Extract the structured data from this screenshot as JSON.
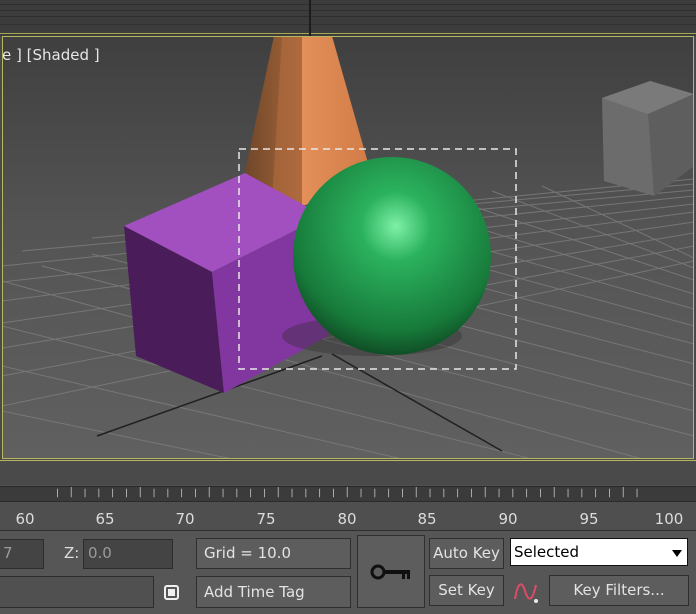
{
  "viewport": {
    "label": "e ] [Shaded ]"
  },
  "timeline": {
    "tick_labels": [
      "60",
      "65",
      "70",
      "75",
      "80",
      "85",
      "90",
      "95",
      "100"
    ]
  },
  "status_bar": {
    "x_field_value": "7",
    "z_label": "Z:",
    "z_field_value": "0.0",
    "grid_label": "Grid = 10.0",
    "add_time_tag_label": "Add Time Tag",
    "auto_key_label": "Auto Key",
    "set_key_label": "Set Key",
    "key_mode_selected": "Selected",
    "key_filters_label": "Key Filters...",
    "key_icon": "key-icon",
    "curve_icon": "curve-editor-icon",
    "lock_icon": "selection-lock-icon"
  },
  "colors": {
    "frame_border": "#b8b860",
    "sphere": "#2aa95a",
    "cube": "#9a3fb5",
    "pyramid": "#c07a45",
    "gray_box": "#6f6f6f"
  }
}
